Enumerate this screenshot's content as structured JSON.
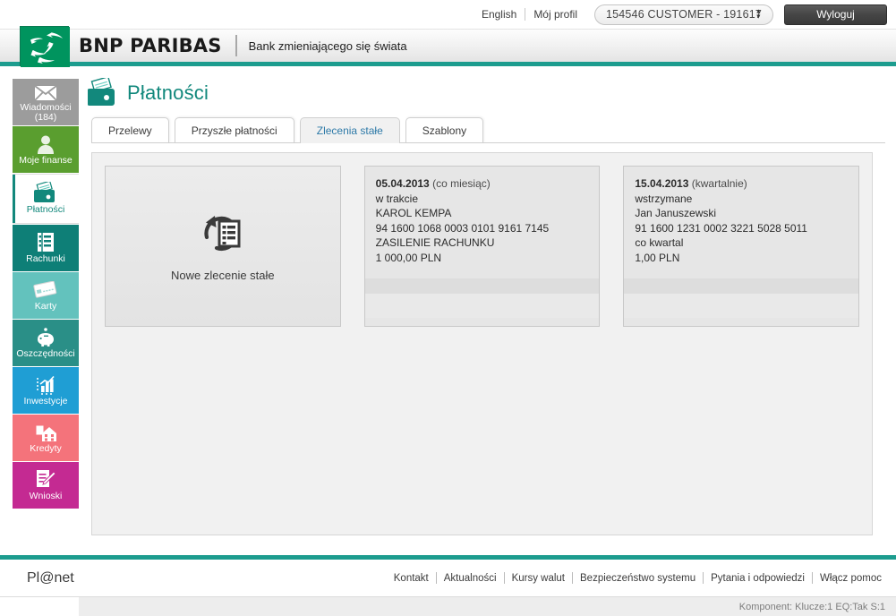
{
  "topbar": {
    "language_link": "English",
    "profile_link": "Mój profil",
    "account_select_value": "154546 CUSTOMER - 191617",
    "logout_label": "Wyloguj"
  },
  "brand": {
    "name": "BNP PARIBAS",
    "tagline": "Bank zmieniającego się świata",
    "accent_color": "#1c9c8e",
    "logo_green": "#00945e"
  },
  "sidebar": {
    "items": [
      {
        "label": "Wiadomości",
        "sub": "(184)",
        "icon": "envelope-icon",
        "color": "#9c9c9c",
        "active": false,
        "key": "wiadomosci"
      },
      {
        "label": "Moje finanse",
        "sub": "",
        "icon": "person-icon",
        "color": "#5a9e2f",
        "active": false,
        "key": "moje-finanse"
      },
      {
        "label": "Płatności",
        "sub": "",
        "icon": "wallet-icon",
        "color": "#ffffff",
        "active": true,
        "key": "platnosci"
      },
      {
        "label": "Rachunki",
        "sub": "",
        "icon": "ledger-icon",
        "color": "#0e7f77",
        "active": false,
        "key": "rachunki"
      },
      {
        "label": "Karty",
        "sub": "",
        "icon": "card-icon",
        "color": "#63c2bd",
        "active": false,
        "key": "karty"
      },
      {
        "label": "Oszczędności",
        "sub": "",
        "icon": "piggy-bank-icon",
        "color": "#2a8f87",
        "active": false,
        "key": "oszczednosci"
      },
      {
        "label": "Inwestycje",
        "sub": "",
        "icon": "bar-chart-icon",
        "color": "#1f9ed4",
        "active": false,
        "key": "inwestycje"
      },
      {
        "label": "Kredyty",
        "sub": "",
        "icon": "house-icon",
        "color": "#f4737b",
        "active": false,
        "key": "kredyty"
      },
      {
        "label": "Wnioski",
        "sub": "",
        "icon": "form-pencil-icon",
        "color": "#c42a92",
        "active": false,
        "key": "wnioski"
      }
    ]
  },
  "page": {
    "title": "Płatności",
    "title_icon": "wallet-icon",
    "tabs": [
      {
        "label": "Przelewy",
        "active": false
      },
      {
        "label": "Przyszłe płatności",
        "active": false
      },
      {
        "label": "Zlecenia stałe",
        "active": true
      },
      {
        "label": "Szablony",
        "active": false
      }
    ]
  },
  "content": {
    "new_order_card": {
      "label": "Nowe zlecenie stałe",
      "icon": "recurring-document-icon"
    },
    "orders": [
      {
        "date": "05.04.2013",
        "frequency_label": "(co miesiąc)",
        "status": "w trakcie",
        "recipient": "KAROL KEMPA",
        "account_number": "94 1600 1068 0003 0101 9161 7145",
        "title": "ZASILENIE RACHUNKU",
        "amount": "1 000,00 PLN"
      },
      {
        "date": "15.04.2013",
        "frequency_label": "(kwartalnie)",
        "status": "wstrzymane",
        "recipient": "Jan Januszewski",
        "account_number": "91 1600 1231 0002 3221 5028 5011",
        "title": "co kwartal",
        "amount": "1,00 PLN"
      }
    ]
  },
  "footer": {
    "logo": "Pl@net",
    "links": [
      "Kontakt",
      "Aktualności",
      "Kursy walut",
      "Bezpieczeństwo systemu",
      "Pytania i odpowiedzi",
      "Włącz pomoc"
    ],
    "status_text": "Komponent: Klucze:1 EQ:Tak S:1"
  }
}
